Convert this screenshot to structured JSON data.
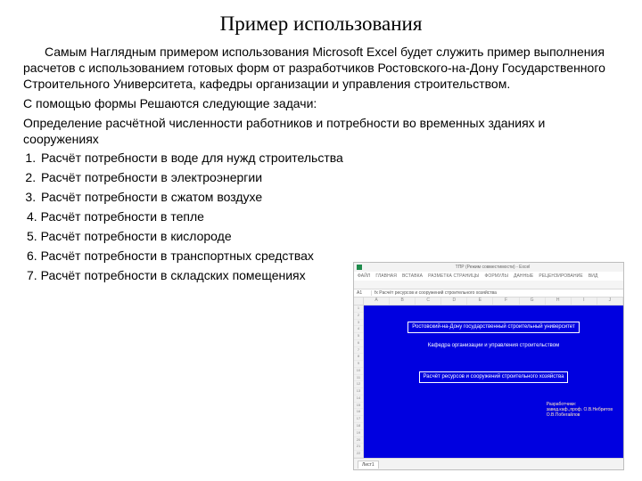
{
  "title": "Пример использования",
  "paragraphs": {
    "p1": "Самым Наглядным примером использования Microsoft Excel будет служить пример выполнения расчетов с использованием готовых форм от разработчиков Ростовского-на-Дону Государственного Строительного Университета, кафедры организации и управления строительством.",
    "p2": "С помощью формы Решаются следующие задачи:",
    "p3": "Определение расчётной численности работников и потребности во временных зданиях и сооружениях"
  },
  "list": {
    "i1": "Расчёт потребности в воде для нужд строительства",
    "i2": "Расчёт потребности в электроэнергии",
    "i3": "Расчёт потребности в сжатом воздухе",
    "i4": "4. Расчёт потребности в тепле",
    "i5": "5. Расчёт потребности в кислороде",
    "i6": "6. Расчёт потребности в транспортных средствах",
    "i7": "7. Расчёт потребности в складских помещениях"
  },
  "excel": {
    "app_line": "ТПР (Режим совместимости) - Excel",
    "menu": [
      "ФАЙЛ",
      "ГЛАВНАЯ",
      "ВСТАВКА",
      "РАЗМЕТКА СТРАНИЦЫ",
      "ФОРМУЛЫ",
      "ДАННЫЕ",
      "РЕЦЕНЗИРОВАНИЕ",
      "ВИД"
    ],
    "cell_ref": "A1",
    "formula_label": "fx   Расчёт ресурсов и сооружений строительного хозяйства",
    "cols": [
      "A",
      "B",
      "C",
      "D",
      "E",
      "F",
      "G",
      "H",
      "I",
      "J"
    ],
    "rows": [
      "1",
      "2",
      "3",
      "4",
      "5",
      "6",
      "7",
      "8",
      "9",
      "10",
      "11",
      "12",
      "13",
      "14",
      "15",
      "16",
      "17",
      "18",
      "19",
      "20",
      "21",
      "22"
    ],
    "sheet": {
      "line1": "Ростовский-на-Дону государственный строительный университет",
      "line2": "Кафедра организации и управления строительством",
      "boxed": "Расчёт ресурсов и сооружений строительного хозяйства",
      "dev_title": "Разработчики:",
      "dev1": "завед.каф.,проф. О.В.Небритов",
      "dev2": "О.В.Побегайлов"
    },
    "tab": "Лист1"
  }
}
